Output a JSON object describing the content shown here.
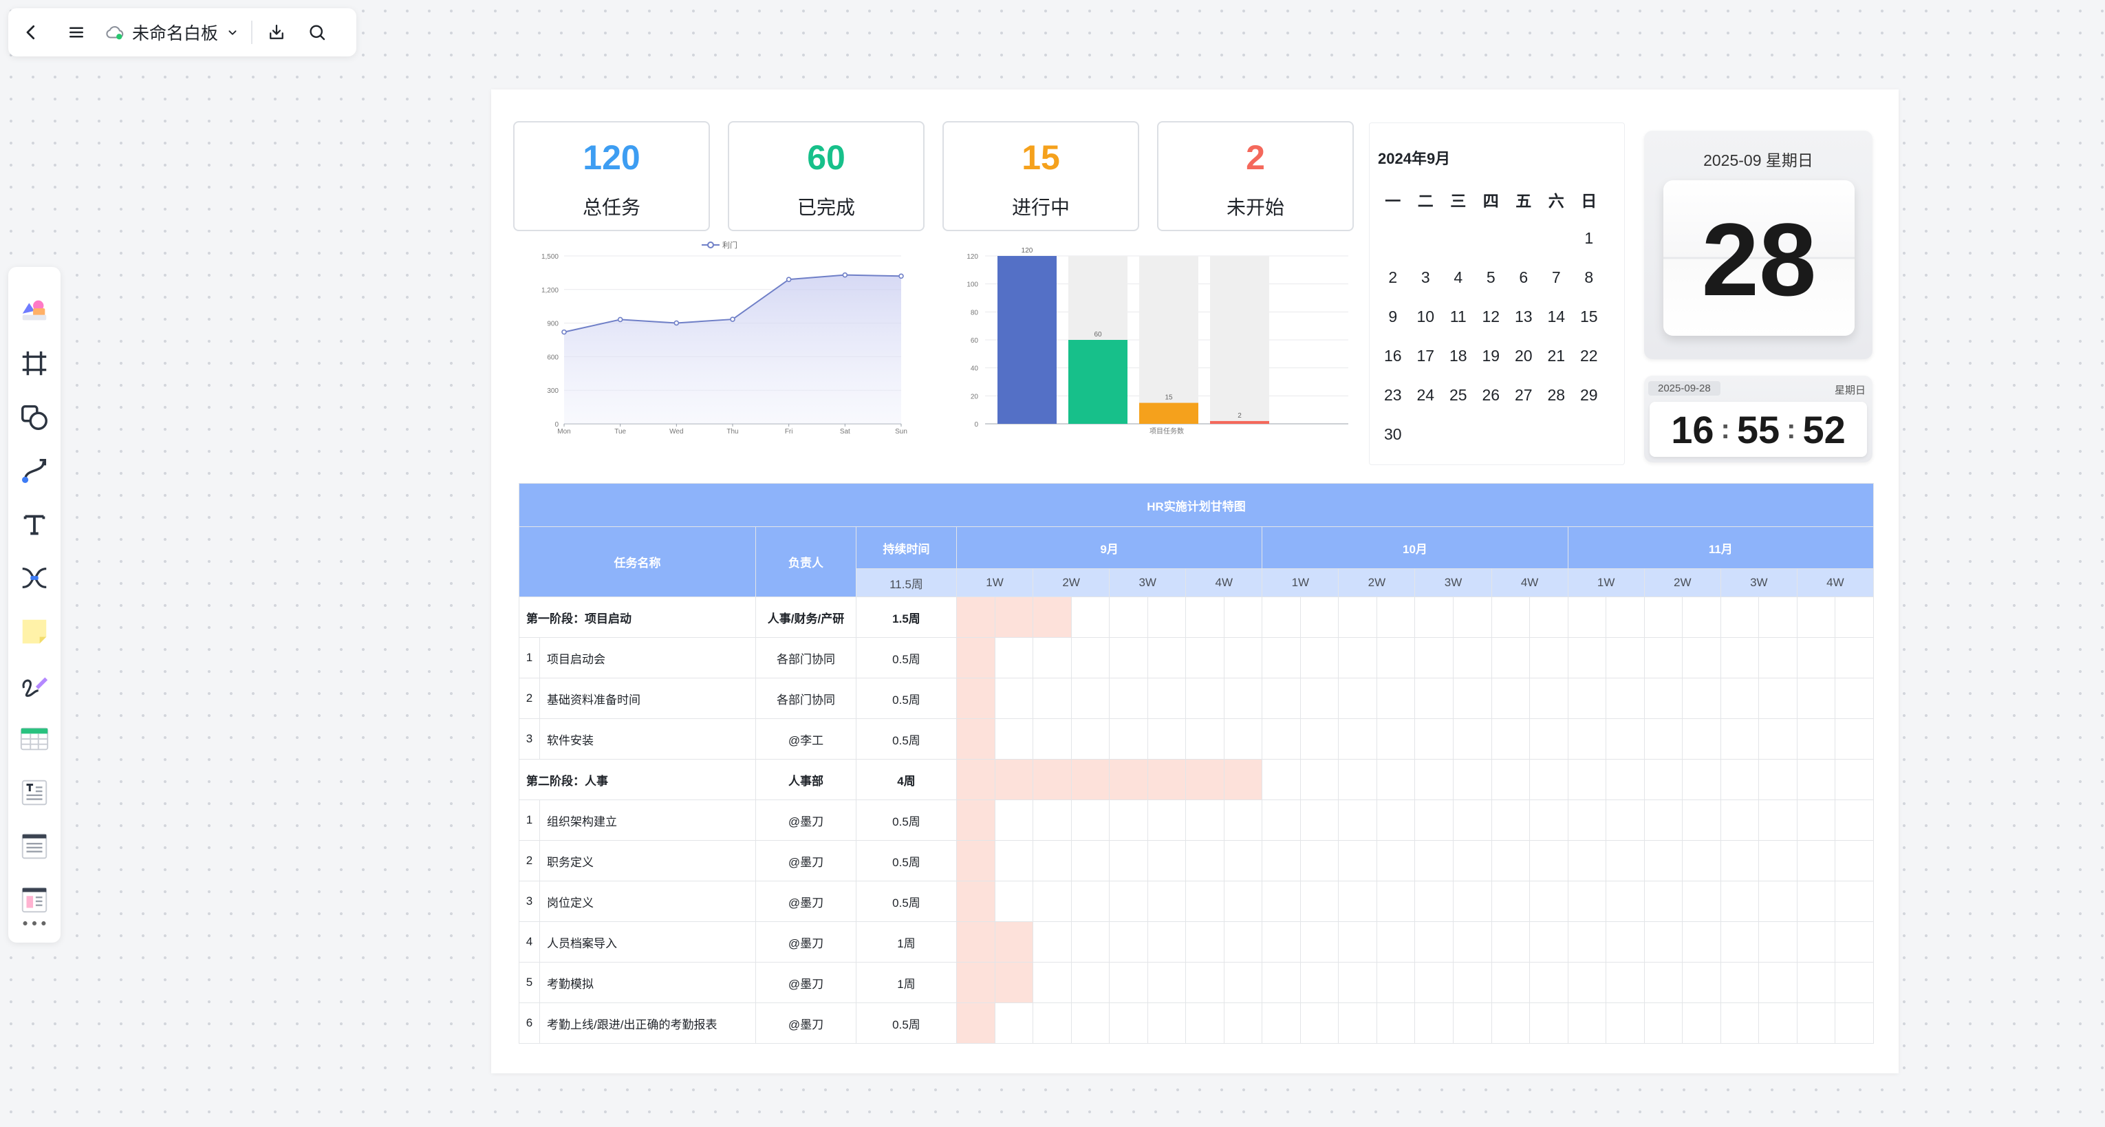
{
  "topbar": {
    "title": "未命名白板"
  },
  "stats": [
    {
      "value": "120",
      "label": "总任务",
      "color": "#3d9df2"
    },
    {
      "value": "60",
      "label": "已完成",
      "color": "#17c08a"
    },
    {
      "value": "15",
      "label": "进行中",
      "color": "#f5a11c"
    },
    {
      "value": "2",
      "label": "未开始",
      "color": "#f4685b"
    }
  ],
  "chart_data": [
    {
      "type": "area",
      "legend": "利门",
      "categories": [
        "Mon",
        "Tue",
        "Wed",
        "Thu",
        "Fri",
        "Sat",
        "Sun"
      ],
      "values": [
        820,
        932,
        901,
        934,
        1290,
        1330,
        1320
      ],
      "ylim": [
        0,
        1500
      ],
      "yticks": [
        0,
        300,
        600,
        900,
        1200,
        1500
      ],
      "ytick_labels": [
        "0",
        "300",
        "600",
        "900",
        "1,200",
        "1,500"
      ],
      "color": "#6f7fc7"
    },
    {
      "type": "bar",
      "categories": [
        "项目任务数"
      ],
      "values": [
        120,
        60,
        15,
        2
      ],
      "colors": [
        "#5470c6",
        "#17c08a",
        "#f5a11c",
        "#f4685b"
      ],
      "background_max": 120,
      "ylim": [
        0,
        120
      ],
      "yticks": [
        0,
        20,
        40,
        60,
        80,
        100,
        120
      ],
      "xlabel": "项目任务数"
    }
  ],
  "calendar": {
    "title": "2024年9月",
    "weekdays": [
      "一",
      "二",
      "三",
      "四",
      "五",
      "六",
      "日"
    ],
    "lead_blanks": 6,
    "days": 30
  },
  "date_widget": {
    "date_text": "2025-09 星期日",
    "day": "28"
  },
  "time_widget": {
    "date": "2025-09-28",
    "weekday": "星期日",
    "hh": "16",
    "mm": "55",
    "ss": "52"
  },
  "gantt": {
    "title": "HR实施计划甘特图",
    "col_task": "任务名称",
    "col_owner": "负责人",
    "col_duration": "持续时间",
    "duration_sub": "11.5周",
    "months": [
      "9月",
      "10月",
      "11月"
    ],
    "weeks": [
      "1W",
      "2W",
      "3W",
      "4W"
    ],
    "rows": [
      {
        "type": "phase",
        "name": "第一阶段：项目启动",
        "owner": "人事/财务/产研",
        "duration": "1.5周",
        "bar": [
          0,
          3
        ]
      },
      {
        "type": "task",
        "no": "1",
        "name": "项目启动会",
        "owner": "各部门协同",
        "duration": "0.5周",
        "bar": [
          0,
          1
        ]
      },
      {
        "type": "task",
        "no": "2",
        "name": "基础资料准备时间",
        "owner": "各部门协同",
        "duration": "0.5周",
        "bar": [
          0,
          1
        ]
      },
      {
        "type": "task",
        "no": "3",
        "name": "软件安装",
        "owner": "@李工",
        "duration": "0.5周",
        "bar": [
          0,
          1
        ]
      },
      {
        "type": "phase",
        "name": "第二阶段：人事",
        "owner": "人事部",
        "duration": "4周",
        "bar": [
          0,
          8
        ]
      },
      {
        "type": "task",
        "no": "1",
        "name": "组织架构建立",
        "owner": "@墨刀",
        "duration": "0.5周",
        "bar": [
          0,
          1
        ]
      },
      {
        "type": "task",
        "no": "2",
        "name": "职务定义",
        "owner": "@墨刀",
        "duration": "0.5周",
        "bar": [
          0,
          1
        ]
      },
      {
        "type": "task",
        "no": "3",
        "name": "岗位定义",
        "owner": "@墨刀",
        "duration": "0.5周",
        "bar": [
          0,
          1
        ]
      },
      {
        "type": "task",
        "no": "4",
        "name": "人员档案导入",
        "owner": "@墨刀",
        "duration": "1周",
        "bar": [
          0,
          2
        ]
      },
      {
        "type": "task",
        "no": "5",
        "name": "考勤模拟",
        "owner": "@墨刀",
        "duration": "1周",
        "bar": [
          0,
          2
        ]
      },
      {
        "type": "task",
        "no": "6",
        "name": "考勤上线/跟进/出正确的考勤报表",
        "owner": "@墨刀",
        "duration": "0.5周",
        "bar": [
          0,
          1
        ]
      }
    ]
  }
}
